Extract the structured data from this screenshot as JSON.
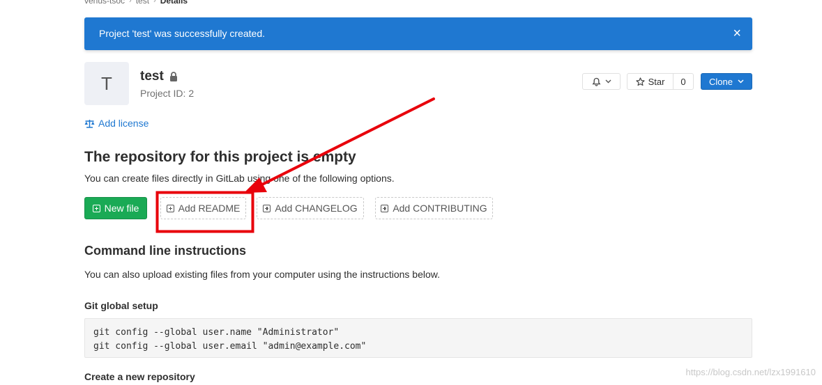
{
  "breadcrumb": {
    "group": "venus-tsoc",
    "project": "test",
    "current": "Details"
  },
  "flash": {
    "message": "Project 'test' was successfully created.",
    "close": "×"
  },
  "project": {
    "avatar_letter": "T",
    "name": "test",
    "id_label": "Project ID:",
    "id_value": "2"
  },
  "actions": {
    "star_label": "Star",
    "star_count": "0",
    "clone_label": "Clone"
  },
  "add_license": "Add license",
  "empty_repo": {
    "title": "The repository for this project is empty",
    "description": "You can create files directly in GitLab using one of the following options."
  },
  "buttons": {
    "new_file": "New file",
    "add_readme": "Add README",
    "add_changelog": "Add CHANGELOG",
    "add_contributing": "Add CONTRIBUTING"
  },
  "cli": {
    "title": "Command line instructions",
    "description": "You can also upload existing files from your computer using the instructions below.",
    "global_setup_title": "Git global setup",
    "global_setup_lines": [
      "git config --global user.name \"Administrator\"",
      "git config --global user.email \"admin@example.com\""
    ],
    "create_repo_title": "Create a new repository"
  },
  "watermark": "https://blog.csdn.net/lzx1991610",
  "colors": {
    "primary": "#1f78d1",
    "success": "#1aaa55",
    "annotation": "#e8000b"
  }
}
